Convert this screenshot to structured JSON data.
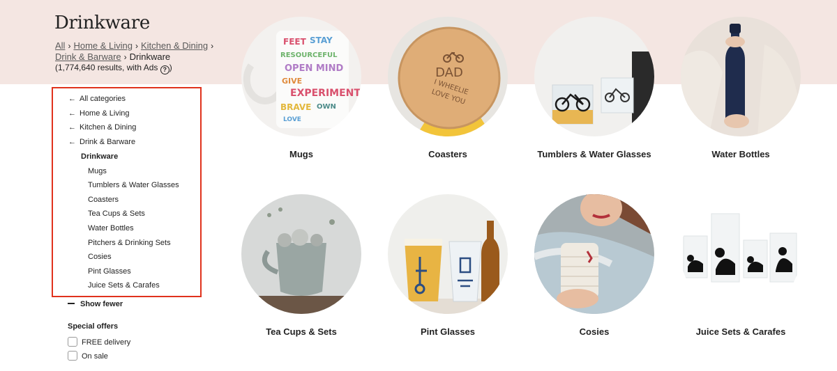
{
  "header": {
    "title": "Drinkware",
    "breadcrumb": {
      "all": "All",
      "home_living": "Home & Living",
      "kitchen_dining": "Kitchen & Dining",
      "drink_barware": "Drink & Barware",
      "current": "Drinkware",
      "separator": "›"
    },
    "results_text": "(1,774,640 results, with Ads",
    "results_close": ")",
    "help_symbol": "?"
  },
  "sidebar": {
    "back_arrow": "←",
    "parents": [
      "All categories",
      "Home & Living",
      "Kitchen & Dining",
      "Drink & Barware"
    ],
    "current": "Drinkware",
    "subcategories": [
      "Mugs",
      "Tumblers & Water Glasses",
      "Coasters",
      "Tea Cups & Sets",
      "Water Bottles",
      "Pitchers & Drinking Sets",
      "Cosies",
      "Pint Glasses",
      "Juice Sets & Carafes"
    ],
    "show_fewer": "Show fewer",
    "special_offers": {
      "title": "Special offers",
      "options": [
        "FREE delivery",
        "On sale"
      ]
    },
    "highlight_color": "#e0321c"
  },
  "grid": {
    "tiles": [
      {
        "label": "Mugs",
        "icon": "mug-image"
      },
      {
        "label": "Coasters",
        "icon": "coaster-image"
      },
      {
        "label": "Tumblers & Water Glasses",
        "icon": "tumbler-image"
      },
      {
        "label": "Water Bottles",
        "icon": "water-bottle-image"
      },
      {
        "label": "Tea Cups & Sets",
        "icon": "tea-cup-image"
      },
      {
        "label": "Pint Glasses",
        "icon": "pint-glass-image"
      },
      {
        "label": "Cosies",
        "icon": "cosy-image"
      },
      {
        "label": "Juice Sets & Carafes",
        "icon": "juice-set-image"
      }
    ],
    "coaster_text": {
      "line1": "DAD",
      "line2": "I WHEELIE",
      "line3": "LOVE YOU"
    }
  },
  "colors": {
    "hero_band": "#f4e6e2",
    "text": "#222222"
  }
}
